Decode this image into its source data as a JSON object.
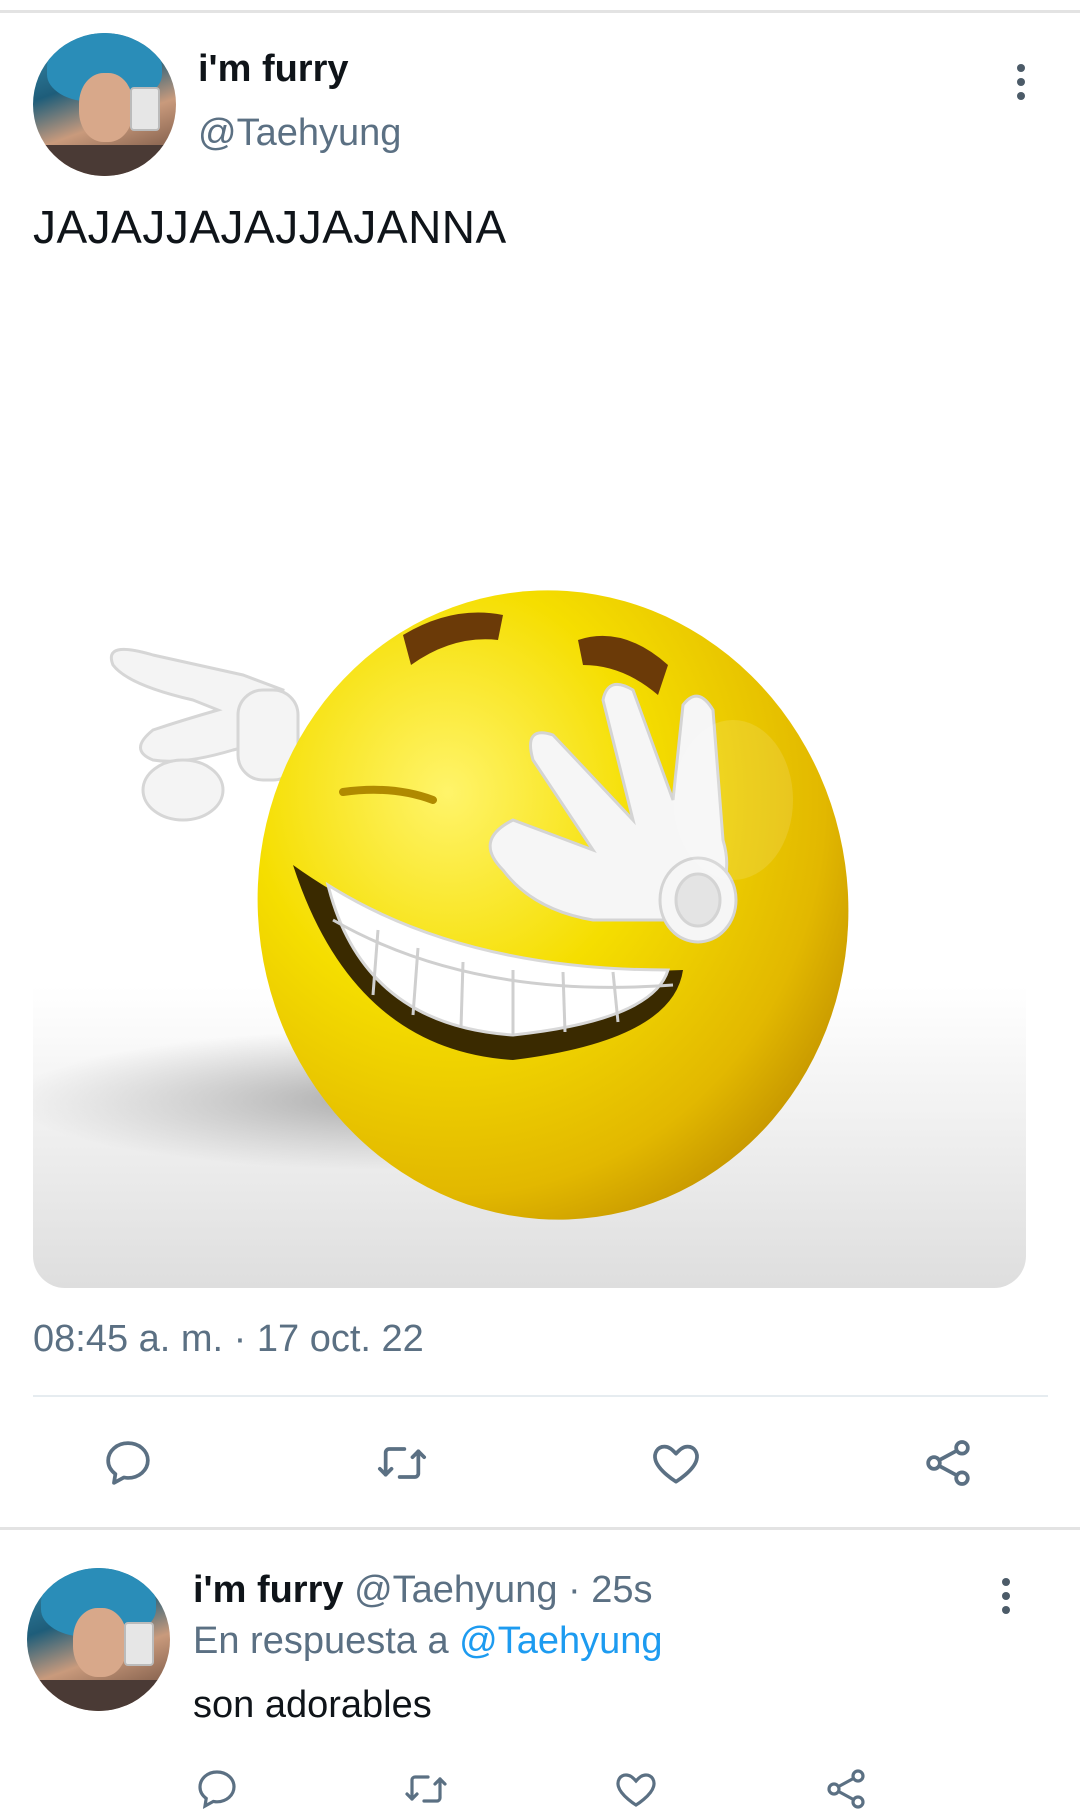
{
  "tweet": {
    "display_name": "i'm furry",
    "handle": "@Taehyung",
    "text": "JAJAJJAJAJJAJANNA",
    "timestamp": "08:45 a. m. · 17 oct. 22",
    "image_description_icon": "laughing-emoji-image"
  },
  "reply": {
    "display_name": "i'm furry",
    "handle": "@Taehyung",
    "time": "· 25s",
    "replying_prefix": "En respuesta a",
    "replying_to": "@Taehyung",
    "text": "son adorables"
  },
  "actions": {
    "reply_icon": "reply-icon",
    "retweet_icon": "retweet-icon",
    "like_icon": "like-icon",
    "share_icon": "share-icon"
  },
  "colors": {
    "link": "#1d9bf0",
    "secondary_text": "#5b7083",
    "icon": "#5b7083",
    "divider": "#e6ecf0"
  }
}
